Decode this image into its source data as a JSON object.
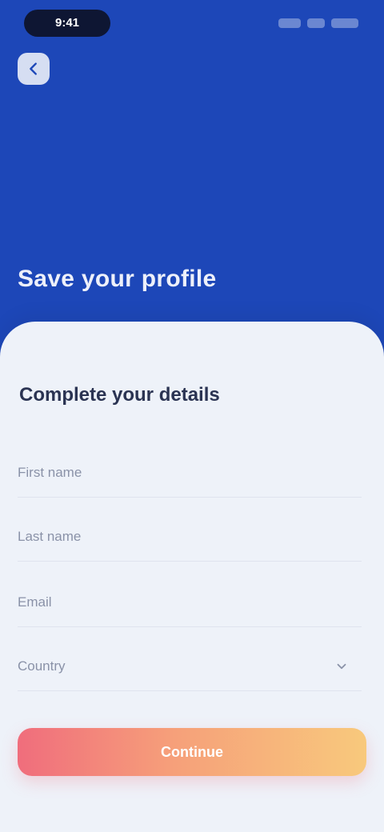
{
  "status_bar": {
    "time": "9:41"
  },
  "header": {
    "back_icon": "arrow-left-icon",
    "title": "Save your profile"
  },
  "form": {
    "title": "Complete your details",
    "fields": [
      {
        "name": "first-name",
        "placeholder": "First name",
        "value": ""
      },
      {
        "name": "last-name",
        "placeholder": "Last name",
        "value": ""
      },
      {
        "name": "email",
        "placeholder": "Email",
        "value": ""
      }
    ],
    "select": {
      "name": "country",
      "value": "Country",
      "icon": "chevron-down-icon"
    },
    "submit_label": "Continue"
  },
  "colors": {
    "header_bg": "#1d47b8",
    "sheet_bg": "#eef2f9",
    "title_text": "#2a3352",
    "button_gradient_start": "#f06d7c",
    "button_gradient_end": "#f8c97c"
  }
}
